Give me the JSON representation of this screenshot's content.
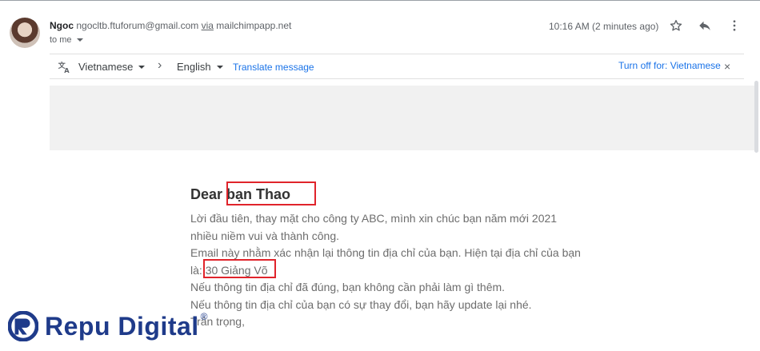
{
  "sender": {
    "name": "Ngoc",
    "email": "ngocltb.ftuforum@gmail.com",
    "via_label": "via",
    "via_domain": "mailchimpapp.net",
    "to_label": "to me"
  },
  "header": {
    "time": "10:16 AM (2 minutes ago)",
    "icons": [
      "star-icon",
      "reply-icon",
      "more-vert-icon"
    ]
  },
  "translate": {
    "from_lang": "Vietnamese",
    "to_lang": "English",
    "translate_link": "Translate message",
    "turn_off": "Turn off for: Vietnamese"
  },
  "email_body": {
    "greeting_prefix": "Dear",
    "greeting_name": "bạn Thao",
    "line1": "Lời đầu tiên, thay mặt cho công ty ABC, mình xin chúc bạn năm mới 2021",
    "line2": "nhiều niềm vui và thành công.",
    "line3": "Email này nhằm xác nhận lại thông tin địa chỉ của bạn. Hiện tại địa chỉ của bạn",
    "line4_prefix": "là:",
    "address": "30 Giảng Võ",
    "line5": "Nếu thông tin địa chỉ đã đúng, bạn không cần phải làm gì thêm.",
    "line6": "Nếu thông tin địa chỉ của bạn có sự thay đổi, bạn hãy update lại nhé.",
    "line7": "Trân trọng,"
  },
  "watermark": {
    "brand": "Repu Digital",
    "reg": "®"
  },
  "colors": {
    "highlight_box": "#e0242b",
    "link": "#1a73e8",
    "brand": "#1f3b8a"
  }
}
